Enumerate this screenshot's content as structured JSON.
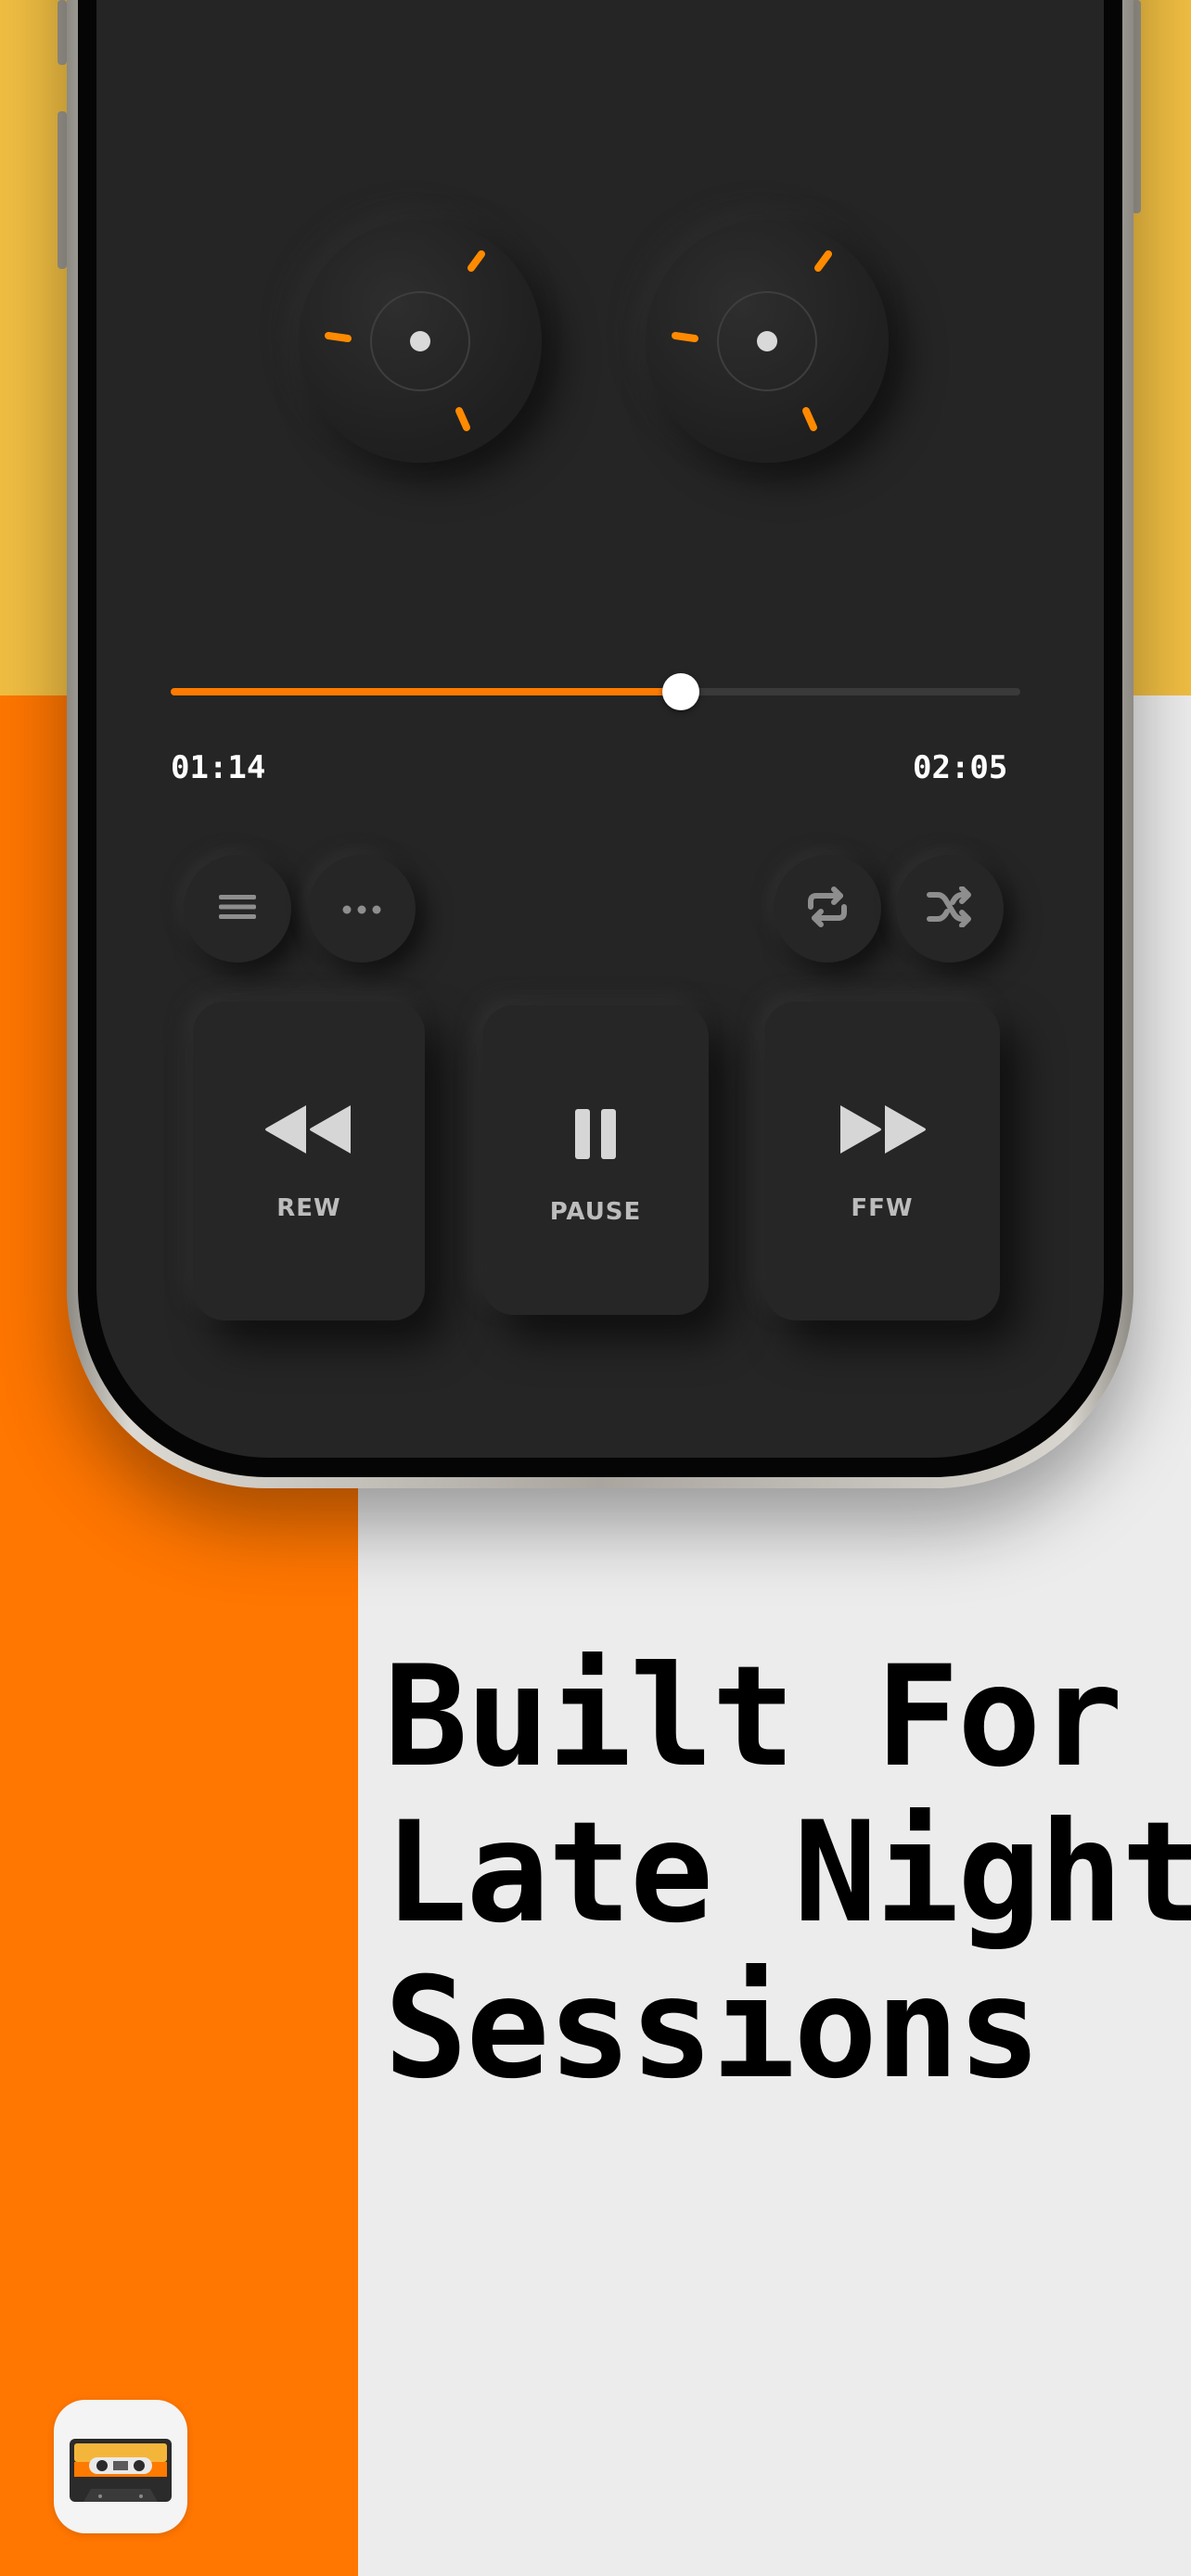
{
  "player": {
    "progress": 0.6,
    "elapsed": "01:14",
    "total": "02:05",
    "accent_color": "#ff7a00"
  },
  "utility_buttons": [
    {
      "icon": "list-icon"
    },
    {
      "icon": "more-icon"
    },
    {
      "icon": "repeat-icon"
    },
    {
      "icon": "shuffle-icon"
    }
  ],
  "transport": {
    "rew_label": "REW",
    "pause_label": "PAUSE",
    "ffw_label": "FFW"
  },
  "headline": {
    "line1": "Built For",
    "line2": "Late Night",
    "line3": "Sessions"
  },
  "app_icon": "cassette-icon",
  "colors": {
    "top_background": "#f0be42",
    "left_background": "#ff7600",
    "right_background": "#ececec",
    "screen": "#252525"
  }
}
